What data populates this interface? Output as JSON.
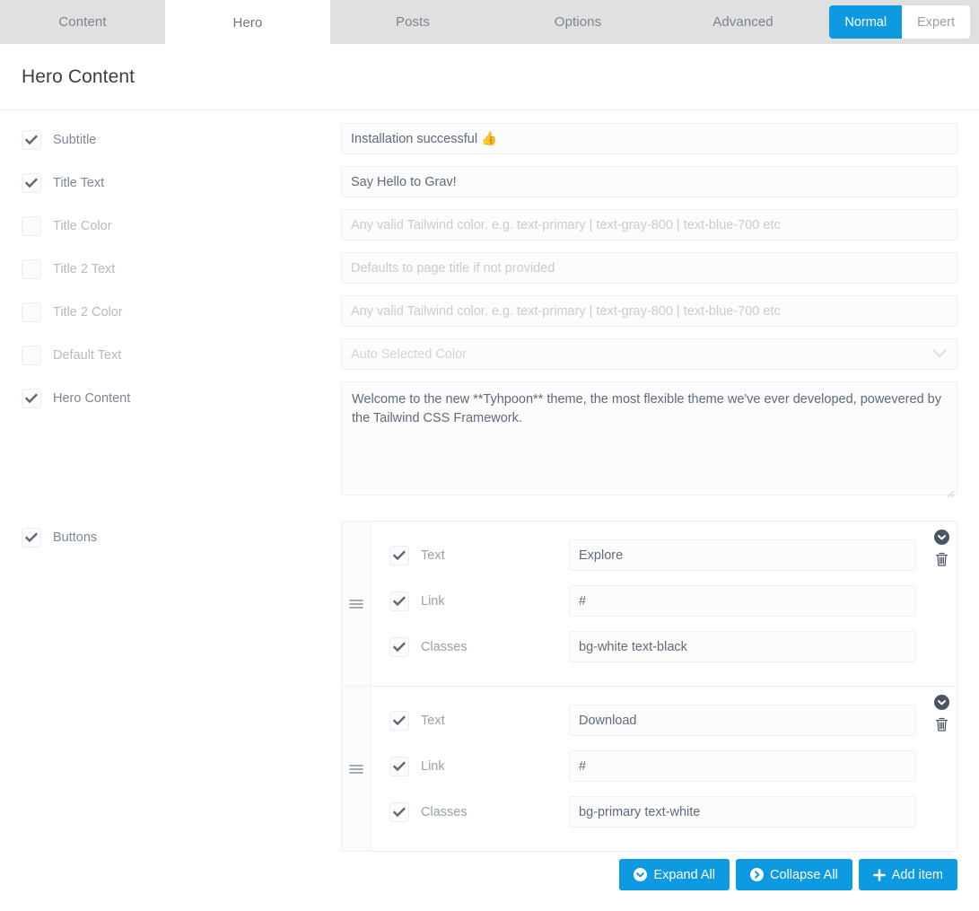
{
  "tabs": [
    {
      "label": "Content",
      "active": false
    },
    {
      "label": "Hero",
      "active": true
    },
    {
      "label": "Posts",
      "active": false
    },
    {
      "label": "Options",
      "active": false
    },
    {
      "label": "Advanced",
      "active": false
    }
  ],
  "mode_toggle": {
    "normal_label": "Normal",
    "expert_label": "Expert",
    "active": "Normal",
    "accent_color": "#0e9ae0"
  },
  "header": {
    "title": "Hero Content"
  },
  "fields": [
    {
      "label": "Subtitle",
      "checked": true,
      "type": "text",
      "value": "Installation successful 👍",
      "placeholder": ""
    },
    {
      "label": "Title Text",
      "checked": true,
      "type": "text",
      "value": "Say Hello to Grav!",
      "placeholder": ""
    },
    {
      "label": "Title Color",
      "checked": false,
      "type": "text",
      "value": "",
      "placeholder": "Any valid Tailwind color, e.g. text-primary | text-gray-800 | text-blue-700 etc"
    },
    {
      "label": "Title 2 Text",
      "checked": false,
      "type": "text",
      "value": "",
      "placeholder": "Defaults to page title if not provided"
    },
    {
      "label": "Title 2 Color",
      "checked": false,
      "type": "text",
      "value": "",
      "placeholder": "Any valid Tailwind color, e.g. text-primary | text-gray-800 | text-blue-700 etc"
    },
    {
      "label": "Default Text",
      "checked": false,
      "type": "select",
      "value": "Auto Selected Color",
      "placeholder": "Auto Selected Color"
    },
    {
      "label": "Hero Content",
      "checked": true,
      "type": "textarea",
      "value": "Welcome to the new **Tyhpoon** theme, the most flexible theme we've ever developed, powevered by the Tailwind CSS Framework.",
      "placeholder": ""
    }
  ],
  "collection": {
    "label": "Buttons",
    "checked": true,
    "items": [
      {
        "fields": [
          {
            "label": "Text",
            "checked": true,
            "value": "Explore"
          },
          {
            "label": "Link",
            "checked": true,
            "value": "#"
          },
          {
            "label": "Classes",
            "checked": true,
            "value": "bg-white text-black"
          }
        ]
      },
      {
        "fields": [
          {
            "label": "Text",
            "checked": true,
            "value": "Download"
          },
          {
            "label": "Link",
            "checked": true,
            "value": "#"
          },
          {
            "label": "Classes",
            "checked": true,
            "value": "bg-primary text-white"
          }
        ]
      }
    ],
    "footer_buttons": [
      {
        "label": "Expand All",
        "icon": "chevron-down-circle-icon"
      },
      {
        "label": "Collapse All",
        "icon": "chevron-right-circle-icon"
      },
      {
        "label": "Add item",
        "icon": "plus-icon"
      }
    ]
  }
}
